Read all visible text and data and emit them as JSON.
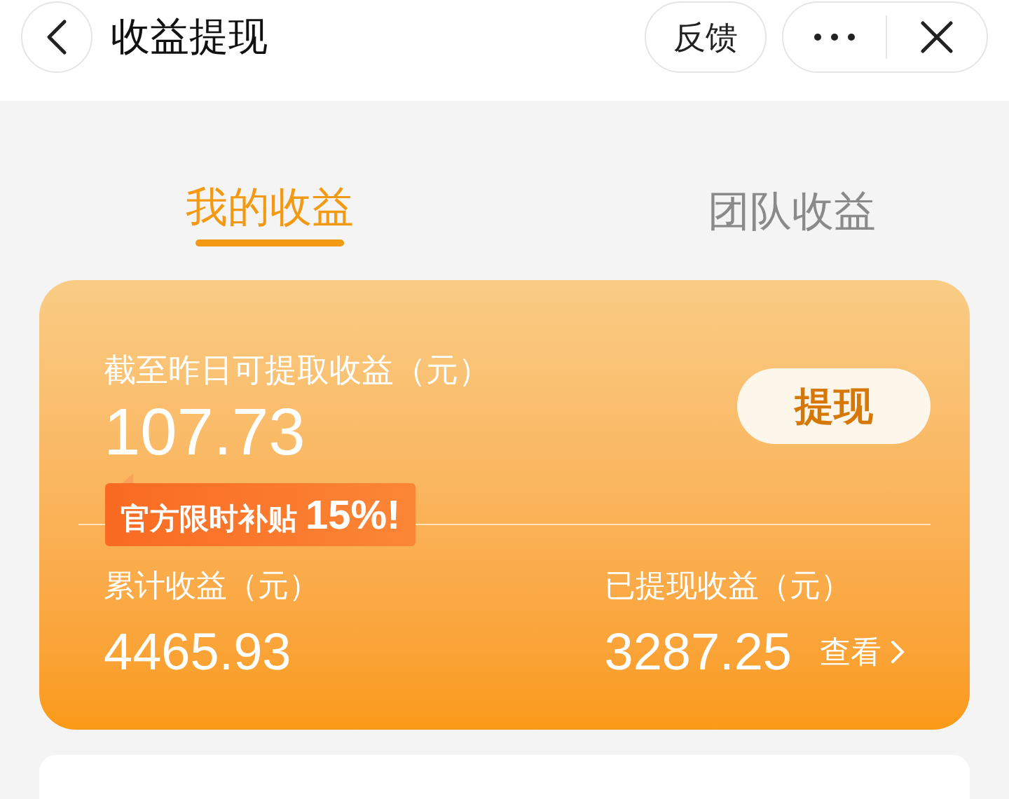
{
  "header": {
    "title": "收益提现",
    "feedback": "反馈"
  },
  "tabs": [
    {
      "label": "我的收益",
      "selected": true
    },
    {
      "label": "团队收益",
      "selected": false
    }
  ],
  "card": {
    "available_label": "截至昨日可提取收益（元）",
    "available_amount": "107.73",
    "withdraw_button": "提现",
    "subsidy_badge": "官方限时补贴**15%!**",
    "total_label": "累计收益（元）",
    "total_amount": "4465.93",
    "withdrawn_label": "已提现收益（元）",
    "withdrawn_amount": "3287.25",
    "view_link": "查看"
  }
}
